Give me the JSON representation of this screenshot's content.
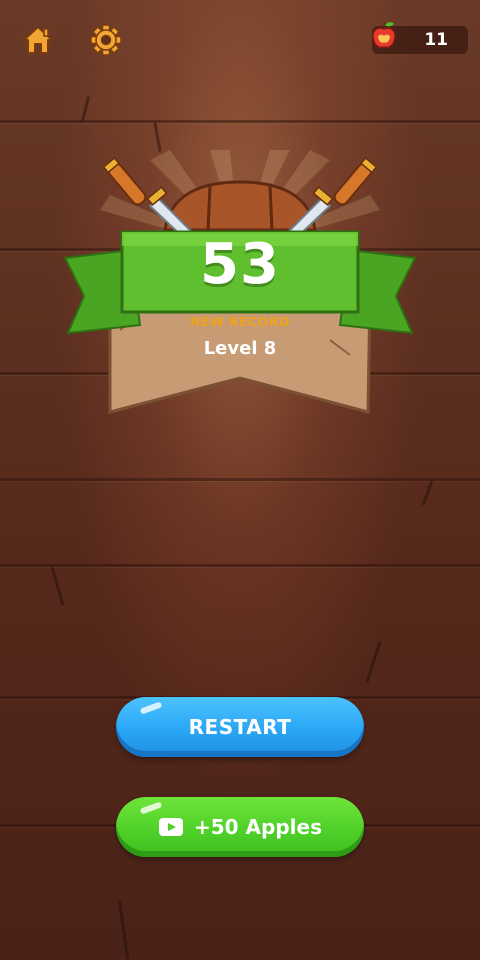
{
  "topbar": {
    "home_icon": "home-icon",
    "settings_icon": "gear-icon",
    "apple_icon": "apple-icon",
    "apple_count": "11"
  },
  "result": {
    "score": "53",
    "record_label": "NEW RECORD",
    "level_label": "Level 8"
  },
  "buttons": {
    "restart_label": "RESTART",
    "apples_label": "+50 Apples",
    "apples_icon": "video-icon"
  },
  "colors": {
    "restart": "#2aa6f5",
    "apples": "#4fd12a",
    "record": "#f0a21c",
    "ribbon": "#5fbf2e"
  }
}
